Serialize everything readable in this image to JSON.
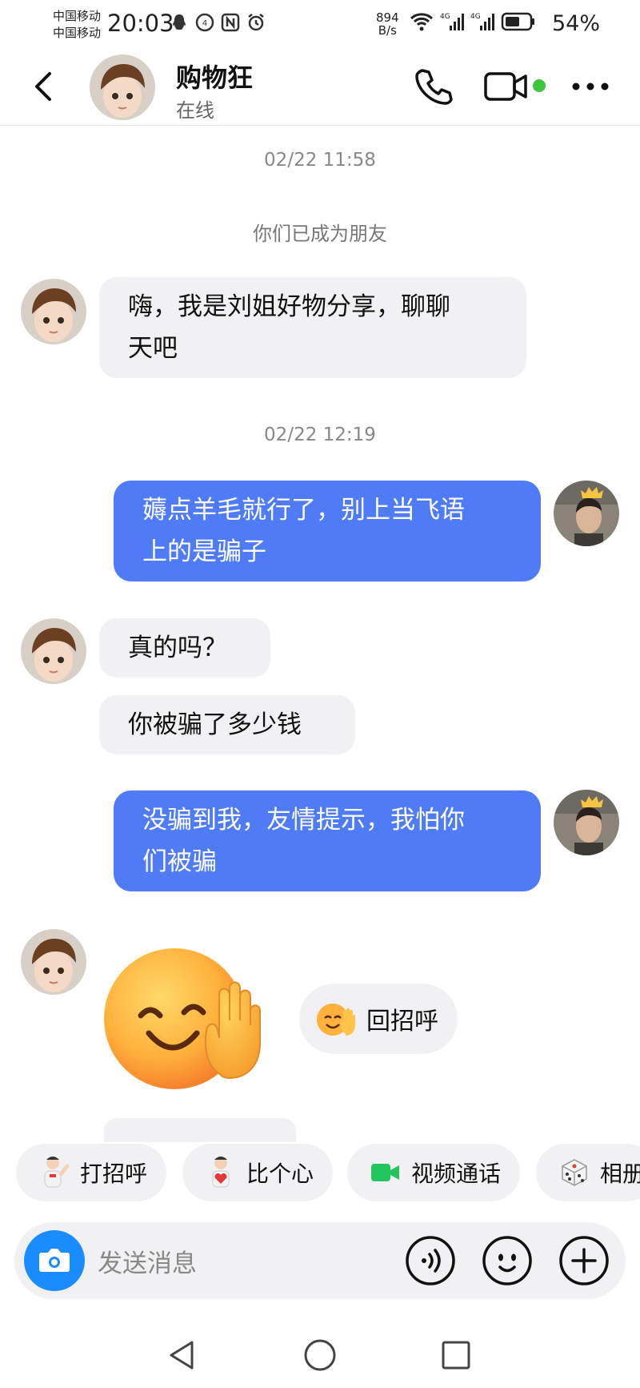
{
  "status_bar": {
    "carrier1": "中国移动",
    "carrier2": "中国移动",
    "time": "20:03",
    "speed_value": "894",
    "speed_unit": "B/s",
    "battery": "54%"
  },
  "header": {
    "contact_name": "购物狂",
    "status": "在线"
  },
  "messages": {
    "ts1": "02/22 11:58",
    "system_friend": "你们已成为朋友",
    "m1_line1": "嗨，我是刘姐好物分享，聊聊",
    "m1_line2": "天吧",
    "ts2": "02/22 12:19",
    "m2_line1": "薅点羊毛就行了，别上当飞语",
    "m2_line2": "上的是骗子",
    "m3": "真的吗？",
    "m4": "你被骗了多少钱",
    "m5_line1": "没骗到我，友情提示，我怕你",
    "m5_line2": "们被骗",
    "reply_greeting": "回招呼"
  },
  "quick_actions": {
    "greet": "打招呼",
    "heart": "比个心",
    "video_call": "视频通话",
    "album": "相册"
  },
  "input": {
    "placeholder": "发送消息"
  },
  "colors": {
    "bubble_out": "#4f7cf6",
    "bubble_in": "#f1f1f3",
    "online_dot": "#3ec73e",
    "camera_button": "#1a8cff"
  }
}
